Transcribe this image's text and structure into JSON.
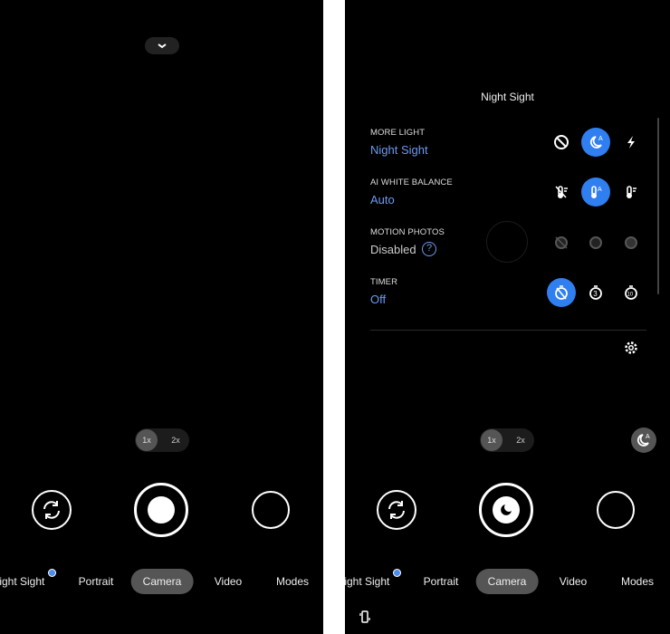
{
  "left_screen": {
    "zoom": {
      "option_1": "1x",
      "option_2": "2x",
      "selected": "1x"
    },
    "modes": [
      {
        "label": "Night Sight",
        "badge": true
      },
      {
        "label": "Portrait"
      },
      {
        "label": "Camera",
        "active": true
      },
      {
        "label": "Video"
      },
      {
        "label": "Modes"
      }
    ]
  },
  "right_screen": {
    "panel": {
      "title": "Night Sight",
      "settings": [
        {
          "label": "MORE LIGHT",
          "value": "Night Sight",
          "options": [
            "off-icon",
            "night-sight-auto-icon",
            "flash-icon"
          ],
          "selected": 1
        },
        {
          "label": "AI WHITE BALANCE",
          "value": "Auto",
          "options": [
            "wb-off-icon",
            "wb-auto-icon",
            "wb-manual-icon"
          ],
          "selected": 1
        },
        {
          "label": "MOTION PHOTOS",
          "value": "Disabled",
          "options": [
            "motion-off-icon",
            "motion-auto-icon",
            "motion-on-icon"
          ],
          "selected": null
        },
        {
          "label": "TIMER",
          "value": "Off",
          "options": [
            "timer-off-icon",
            "timer-3-icon",
            "timer-10-icon"
          ],
          "selected": 0
        }
      ]
    },
    "zoom": {
      "option_1": "1x",
      "option_2": "2x",
      "selected": "1x"
    },
    "modes": [
      {
        "label": "Night Sight",
        "badge": true
      },
      {
        "label": "Portrait"
      },
      {
        "label": "Camera",
        "active": true
      },
      {
        "label": "Video"
      },
      {
        "label": "Modes"
      }
    ]
  },
  "colors": {
    "accent": "#2f7ff0",
    "value_text": "#6c9af0",
    "background": "#000000"
  }
}
